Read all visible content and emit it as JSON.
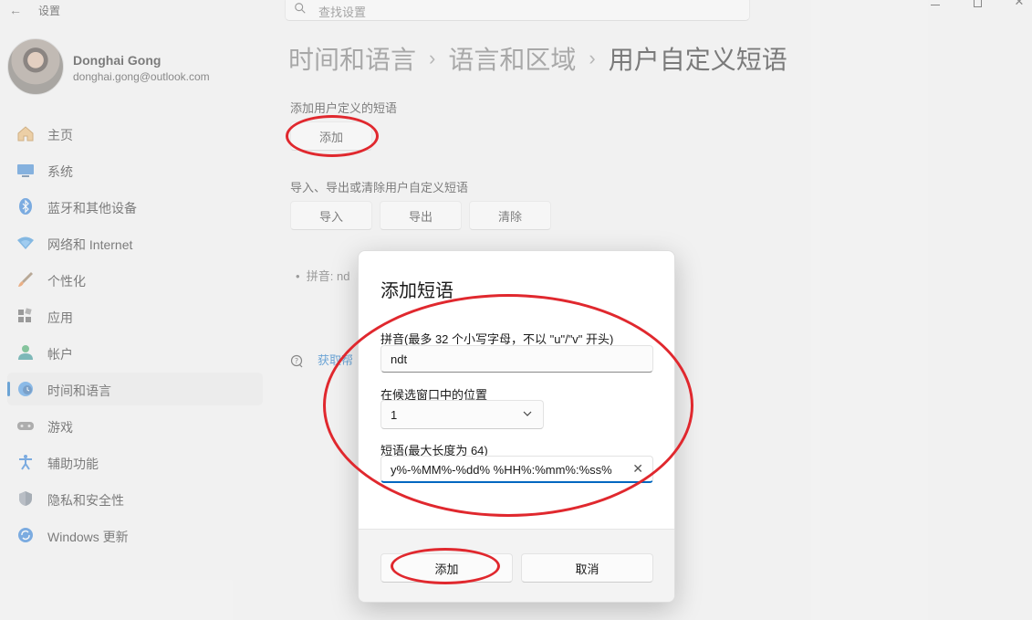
{
  "window": {
    "app_title": "设置",
    "search_placeholder": "查找设置"
  },
  "profile": {
    "name": "Donghai Gong",
    "email": "donghai.gong@outlook.com"
  },
  "sidebar": {
    "items": [
      {
        "label": "主页",
        "icon": "home-icon",
        "active": false
      },
      {
        "label": "系统",
        "icon": "system-icon",
        "active": false
      },
      {
        "label": "蓝牙和其他设备",
        "icon": "bluetooth-icon",
        "active": false
      },
      {
        "label": "网络和 Internet",
        "icon": "network-icon",
        "active": false
      },
      {
        "label": "个性化",
        "icon": "brush-icon",
        "active": false
      },
      {
        "label": "应用",
        "icon": "apps-icon",
        "active": false
      },
      {
        "label": "帐户",
        "icon": "account-icon",
        "active": false
      },
      {
        "label": "时间和语言",
        "icon": "time-language-icon",
        "active": true
      },
      {
        "label": "游戏",
        "icon": "gaming-icon",
        "active": false
      },
      {
        "label": "辅助功能",
        "icon": "accessibility-icon",
        "active": false
      },
      {
        "label": "隐私和安全性",
        "icon": "shield-icon",
        "active": false
      },
      {
        "label": "Windows 更新",
        "icon": "update-icon",
        "active": false
      }
    ]
  },
  "breadcrumb": {
    "level1": "时间和语言",
    "level2": "语言和区域",
    "current": "用户自定义短语",
    "separator": "›"
  },
  "main": {
    "add_section_label": "添加用户定义的短语",
    "add_button": "添加",
    "manage_section_label": "导入、导出或清除用户自定义短语",
    "import_button": "导入",
    "export_button": "导出",
    "clear_button": "清除",
    "existing_entry": "拼音: nd",
    "help_link": "获取帮"
  },
  "dialog": {
    "title": "添加短语",
    "pinyin_label": "拼音(最多 32 个小写字母，不以 \"u\"/\"v\" 开头)",
    "pinyin_value": "ndt",
    "position_label": "在候选窗口中的位置",
    "position_value": "1",
    "phrase_label": "短语(最大长度为 64)",
    "phrase_value": "y%-%MM%-%dd% %HH%:%mm%:%ss%",
    "add_button": "添加",
    "cancel_button": "取消"
  },
  "colors": {
    "accent": "#0067c0",
    "annotation": "#e0282e"
  }
}
